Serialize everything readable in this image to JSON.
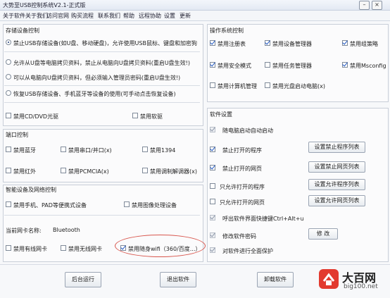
{
  "window": {
    "title": "大势至USB控制系统V2.1-正式版"
  },
  "menu": [
    "关于软件",
    "关于我们",
    "访问官网",
    "购买流程",
    "联系我们",
    "帮助",
    "远程协助",
    "设置",
    "更新"
  ],
  "storage": {
    "title": "存储设备控制",
    "options": [
      "禁止USB存储设备(如U盘、移动硬盘)，允许使用USB鼠标、键盘和加密狗",
      "允许从U盘等电脑拷贝资料，禁止从电脑向U盘拷贝资料(重启U盘生效!)",
      "可以从电脑向U盘拷贝资料，但必须输入管理员密码(重启U盘生效!)",
      "恢复USB存储设备、手机蓝牙等设备的使用(可手动点击恢复设备)"
    ],
    "cd_label": "禁用CD/DVD光驱",
    "floppy_label": "禁用软驱"
  },
  "ports": {
    "title": "端口控制",
    "items": [
      "禁用蓝牙",
      "禁用串口/并口(x)",
      "禁用1394",
      "禁用红外",
      "禁用PCMCIA(x)",
      "禁用调制解调器(x)"
    ]
  },
  "smart": {
    "title": "智能设备及网络控制",
    "phone_label": "禁用手机、PAD等便携式设备",
    "imaging_label": "禁用图像处理设备",
    "nic_caption": "当前网卡名称:",
    "nic_name": "Bluetooth",
    "wired_label": "禁用有线网卡",
    "wireless_label": "禁用无线网卡",
    "wifi_label": "禁用随身wifi（360/百度...）"
  },
  "os": {
    "title": "操作系统控制",
    "items": [
      "禁用注册表",
      "禁用设备管理器",
      "禁用组策略",
      "禁用安全模式",
      "禁用任务管理器",
      "禁用Msconfig",
      "禁用计算机管理",
      "禁用光盘启动电脑(x)"
    ]
  },
  "software": {
    "title": "软件设置",
    "autostart": "随电脑启动自动启动",
    "block_programs": "禁止打开的程序",
    "block_programs_btn": "设置禁止程序列表",
    "block_web": "禁止打开的网页",
    "block_web_btn": "设置禁止网页列表",
    "allow_programs": "只允许打开的程序",
    "allow_programs_btn": "设置允许程序列表",
    "allow_web": "只允许打开的网页",
    "allow_web_btn": "设置允许网页列表",
    "hotkey": "呼出软件界面快捷键Ctrl+Alt+u",
    "password": "修改软件密码",
    "password_btn": "修 改",
    "protect": "对软件进行全面保护"
  },
  "bottom": {
    "background_btn": "后台运行",
    "exit_btn": "退出软件",
    "uninstall_btn": "卸载软件"
  },
  "watermark": {
    "title": "大百网",
    "url": "big100.net"
  }
}
